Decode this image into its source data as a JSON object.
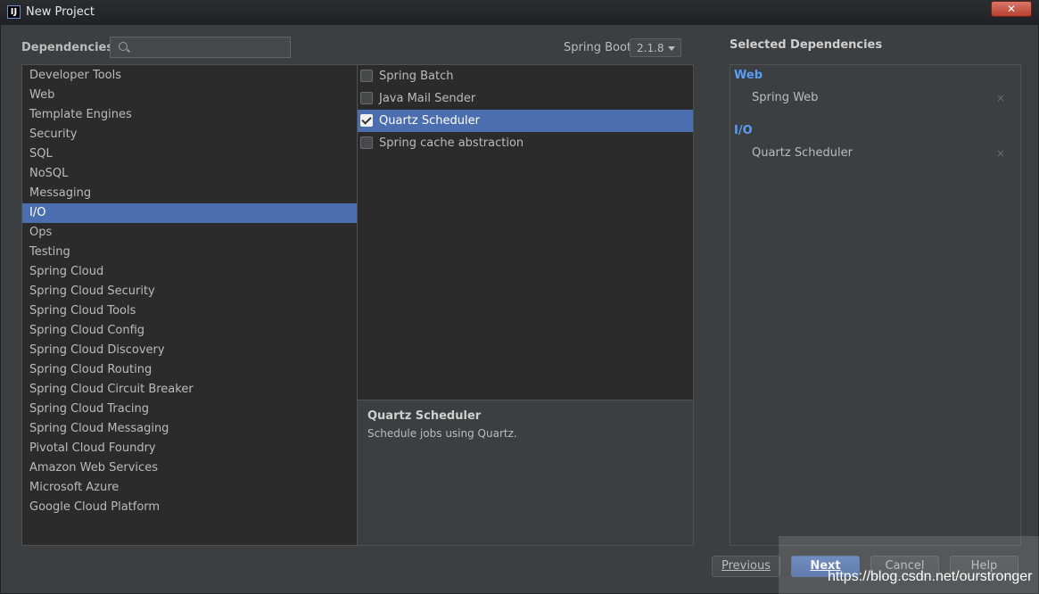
{
  "window": {
    "title": "New Project",
    "app_icon": "IJ",
    "close_glyph": "✕"
  },
  "header": {
    "dependencies_label": "Dependencies",
    "search": {
      "value": "",
      "placeholder": ""
    },
    "spring_boot_label": "Spring Boot",
    "spring_boot_version": "2.1.8"
  },
  "categories": {
    "selected": "I/O",
    "items": [
      "Developer Tools",
      "Web",
      "Template Engines",
      "Security",
      "SQL",
      "NoSQL",
      "Messaging",
      "I/O",
      "Ops",
      "Testing",
      "Spring Cloud",
      "Spring Cloud Security",
      "Spring Cloud Tools",
      "Spring Cloud Config",
      "Spring Cloud Discovery",
      "Spring Cloud Routing",
      "Spring Cloud Circuit Breaker",
      "Spring Cloud Tracing",
      "Spring Cloud Messaging",
      "Pivotal Cloud Foundry",
      "Amazon Web Services",
      "Microsoft Azure",
      "Google Cloud Platform"
    ]
  },
  "dependencies": [
    {
      "label": "Spring Batch",
      "checked": false,
      "selected": false
    },
    {
      "label": "Java Mail Sender",
      "checked": false,
      "selected": false
    },
    {
      "label": "Quartz Scheduler",
      "checked": true,
      "selected": true
    },
    {
      "label": "Spring cache abstraction",
      "checked": false,
      "selected": false
    }
  ],
  "description": {
    "title": "Quartz Scheduler",
    "text": "Schedule jobs using Quartz."
  },
  "selected_dependencies": {
    "title": "Selected Dependencies",
    "groups": [
      {
        "name": "Web",
        "items": [
          "Spring Web"
        ]
      },
      {
        "name": "I/O",
        "items": [
          "Quartz Scheduler"
        ]
      }
    ],
    "remove_glyph": "×"
  },
  "buttons": {
    "previous": "Previous",
    "next": "Next",
    "cancel": "Cancel",
    "help": "Help"
  },
  "watermark": "https://blog.csdn.net/ourstronger",
  "colors": {
    "selection": "#4b6eaf",
    "group_header": "#589df6",
    "background": "#3c3f41"
  }
}
